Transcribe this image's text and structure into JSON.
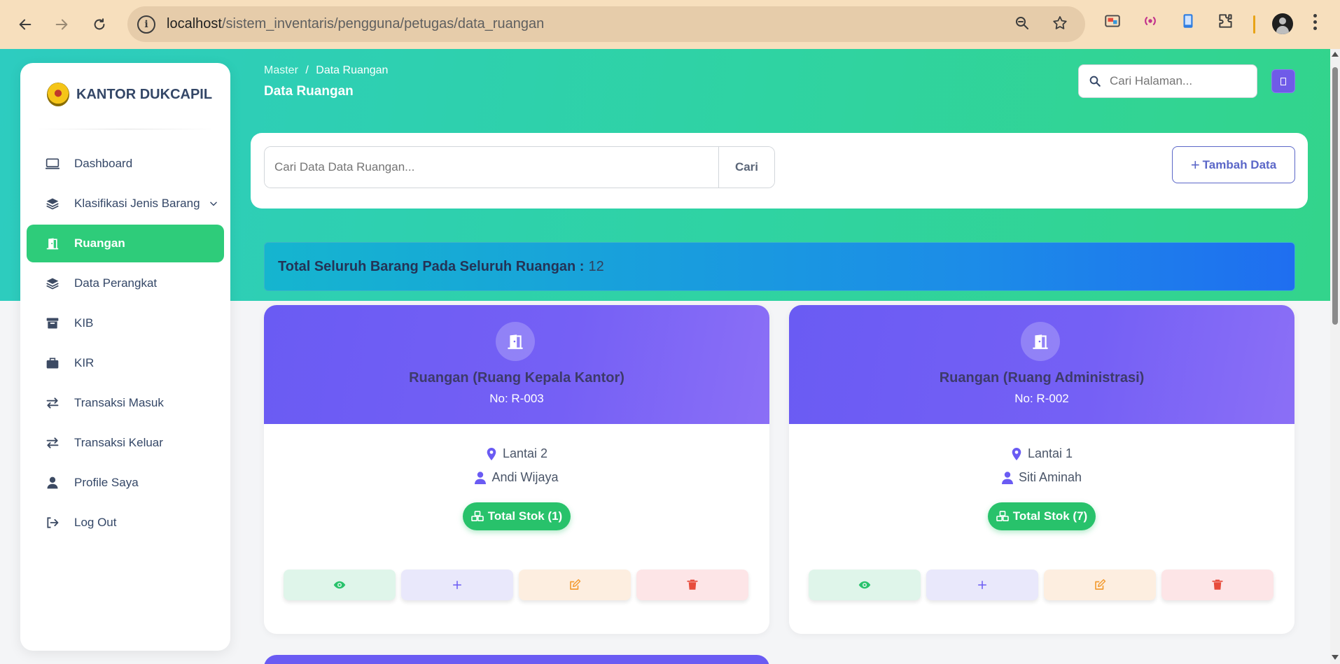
{
  "browser": {
    "url_host": "localhost",
    "url_path": "/sistem_inventaris/pengguna/petugas/data_ruangan"
  },
  "brand": {
    "name": "KANTOR DUKCAPIL"
  },
  "sidebar": {
    "items": [
      {
        "label": "Dashboard",
        "icon": "monitor-icon",
        "active": false
      },
      {
        "label": "Klasifikasi Jenis Barang",
        "icon": "layers-icon",
        "active": false,
        "has_dropdown": true
      },
      {
        "label": "Ruangan",
        "icon": "door-icon",
        "active": true
      },
      {
        "label": "Data Perangkat",
        "icon": "layers-icon",
        "active": false
      },
      {
        "label": "KIB",
        "icon": "archive-icon",
        "active": false
      },
      {
        "label": "KIR",
        "icon": "briefcase-icon",
        "active": false
      },
      {
        "label": "Transaksi Masuk",
        "icon": "exchange-icon",
        "active": false
      },
      {
        "label": "Transaksi Keluar",
        "icon": "exchange-icon",
        "active": false
      },
      {
        "label": "Profile Saya",
        "icon": "user-icon",
        "active": false
      },
      {
        "label": "Log Out",
        "icon": "logout-icon",
        "active": false
      }
    ]
  },
  "header": {
    "breadcrumb_root": "Master",
    "breadcrumb_sep": "/",
    "breadcrumb_current": "Data Ruangan",
    "title": "Data Ruangan",
    "search_placeholder": "Cari Halaman..."
  },
  "toolbar": {
    "search_placeholder": "Cari Data Data Ruangan...",
    "search_button": "Cari",
    "add_button": "Tambah Data"
  },
  "summary": {
    "label": "Total Seluruh Barang Pada Seluruh Ruangan :",
    "value": "12"
  },
  "rooms": [
    {
      "title": "Ruangan (Ruang Kepala Kantor)",
      "number": "No: R-003",
      "floor": "Lantai 2",
      "person": "Andi Wijaya",
      "stock_label": "Total Stok (1)"
    },
    {
      "title": "Ruangan (Ruang Administrasi)",
      "number": "No: R-002",
      "floor": "Lantai 1",
      "person": "Siti Aminah",
      "stock_label": "Total Stok (7)"
    }
  ],
  "colors": {
    "accent_green": "#2ecc7a",
    "card_purple": "#6a5bf3",
    "banner_blue": "#1c8be8"
  }
}
